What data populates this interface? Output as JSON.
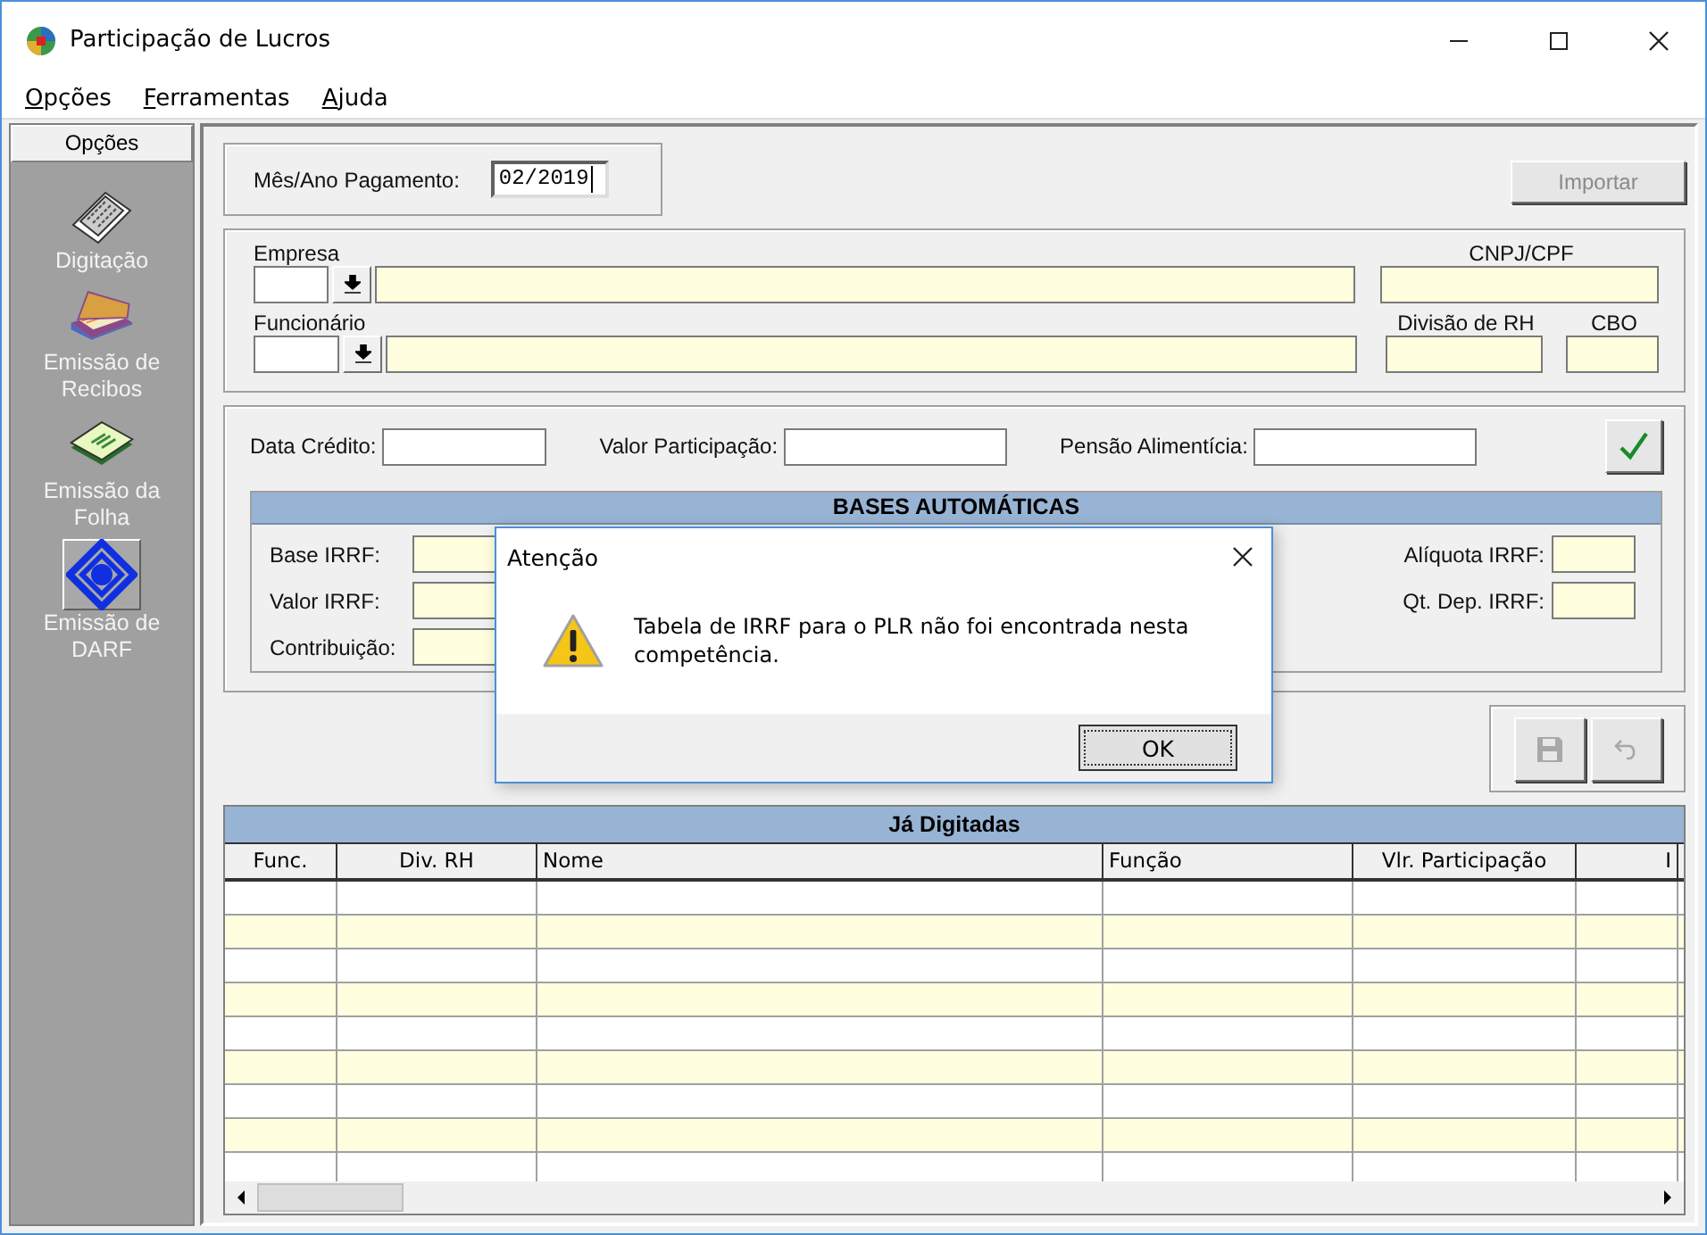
{
  "window": {
    "title": "Participação de Lucros"
  },
  "menu": [
    {
      "label": "Opções"
    },
    {
      "label": "Ferramentas"
    },
    {
      "label": "Ajuda"
    }
  ],
  "sidebar": {
    "title": "Opções",
    "items": [
      {
        "label": "Digitação",
        "kind": "keyboard",
        "selected": false
      },
      {
        "label": "Emissão de Recibos",
        "kind": "scanner",
        "selected": false
      },
      {
        "label": "Emissão da Folha",
        "kind": "sheet",
        "selected": false
      },
      {
        "label": "Emissão de DARF",
        "kind": "darf",
        "selected": true
      }
    ]
  },
  "payment": {
    "label": "Mês/Ano Pagamento:",
    "value": "02/2019"
  },
  "import_button": {
    "label": "Importar",
    "disabled": true
  },
  "empresa": {
    "label": "Empresa",
    "cnpj_label": "CNPJ/CPF"
  },
  "funcionario": {
    "label": "Funcionário",
    "divisao_label": "Divisão de RH",
    "cbo_label": "CBO"
  },
  "credit_fields": [
    {
      "label": "Data Crédito:"
    },
    {
      "label": "Valor Participação:"
    },
    {
      "label": "Pensão Alimentícia:"
    }
  ],
  "bases": {
    "title": "BASES AUTOMÁTICAS",
    "left": [
      {
        "label": "Base IRRF:"
      },
      {
        "label": "Valor IRRF:"
      },
      {
        "label": "Contribuição:"
      }
    ],
    "right": [
      {
        "label": "Alíquota IRRF:"
      },
      {
        "label": "Qt. Dep. IRRF:"
      }
    ]
  },
  "actions": [
    {
      "kind": "save",
      "disabled": true
    },
    {
      "kind": "undo",
      "disabled": true
    }
  ],
  "grid": {
    "title": "Já Digitadas",
    "columns": [
      "Func.",
      "Div. RH",
      "Nome",
      "Função",
      "Vlr. Participação",
      "I"
    ]
  },
  "dialog": {
    "title": "Atenção",
    "message": "Tabela de IRRF para o PLR não foi encontrada nesta competência.",
    "button": "OK"
  }
}
